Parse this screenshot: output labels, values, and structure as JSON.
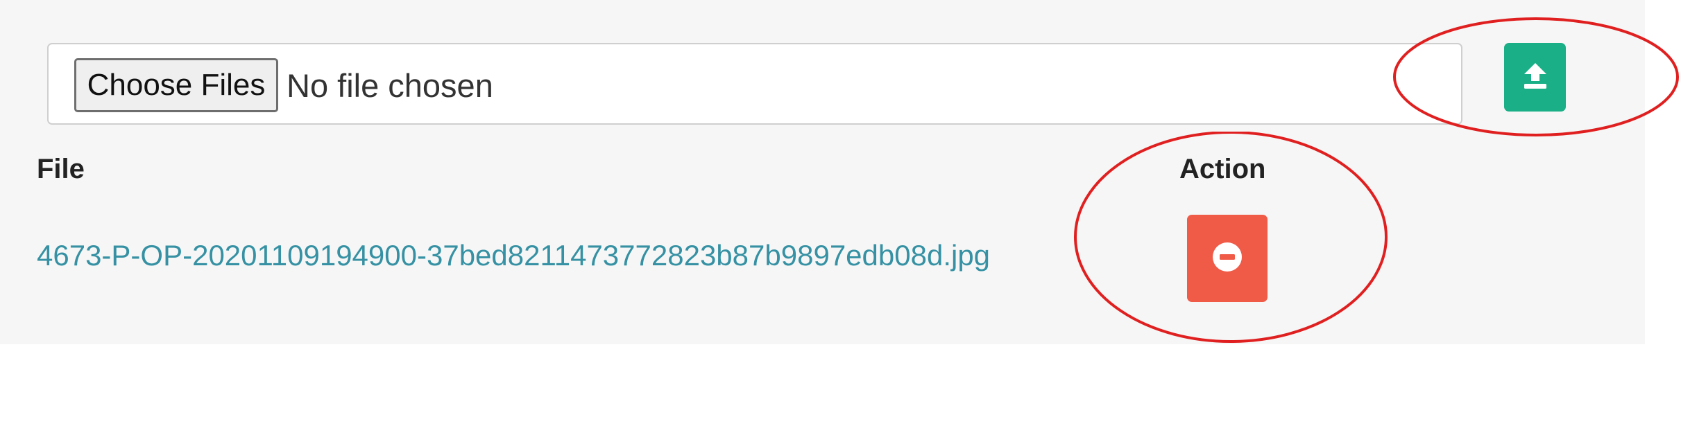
{
  "upload": {
    "choose_label": "Choose Files",
    "status_text": "No file chosen",
    "upload_icon": "upload-icon",
    "upload_color": "#1aaf86"
  },
  "table": {
    "headers": {
      "file": "File",
      "action": "Action"
    },
    "rows": [
      {
        "file_name": "4673-P-OP-20201109194900-37bed8211473772823b87b9897edb08d.jpg",
        "action_icon": "minus-circle-icon"
      }
    ]
  },
  "colors": {
    "link": "#3591a3",
    "remove": "#f05b48",
    "annotation": "#e02020",
    "panel_bg": "#f6f6f6"
  }
}
